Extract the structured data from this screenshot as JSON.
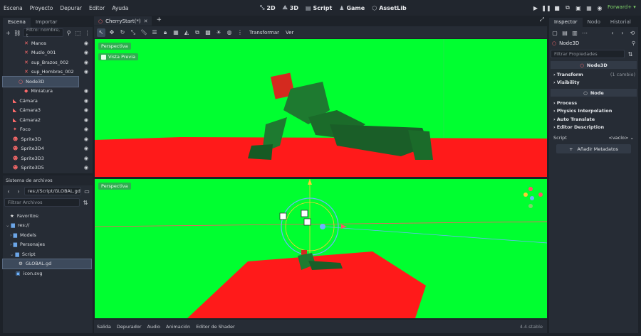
{
  "menubar": {
    "menus": [
      "Escena",
      "Proyecto",
      "Depurar",
      "Editor",
      "Ayuda"
    ],
    "workspaces": [
      {
        "label": "2D",
        "icon": "2d-icon"
      },
      {
        "label": "3D",
        "icon": "3d-icon"
      },
      {
        "label": "Script",
        "icon": "script-icon"
      },
      {
        "label": "Game",
        "icon": "game-icon"
      },
      {
        "label": "AssetLib",
        "icon": "assetlib-icon"
      }
    ],
    "renderer": "Forward+"
  },
  "scene_panel": {
    "tabs": [
      "Escena",
      "Importar"
    ],
    "filter_placeholder": "Filtro: nombre, t",
    "nodes": [
      {
        "label": "Manos",
        "icon": "bone-icon"
      },
      {
        "label": "Muslo_001",
        "icon": "bone-icon"
      },
      {
        "label": "sup_Brazos_002",
        "icon": "bone-icon"
      },
      {
        "label": "sup_Hombros_002",
        "icon": "bone-icon"
      },
      {
        "label": "Node3D",
        "icon": "node3d-icon"
      },
      {
        "label": "Miniatura",
        "icon": "mesh-icon"
      },
      {
        "label": "Cámara",
        "icon": "camera-icon"
      },
      {
        "label": "Cámara3",
        "icon": "camera-icon"
      },
      {
        "label": "Cámara2",
        "icon": "camera-icon"
      },
      {
        "label": "Foco",
        "icon": "light-icon"
      },
      {
        "label": "Sprite3D",
        "icon": "sprite-icon"
      },
      {
        "label": "Sprite3D4",
        "icon": "sprite-icon"
      },
      {
        "label": "Sprite3D3",
        "icon": "sprite-icon"
      },
      {
        "label": "Sprite3D5",
        "icon": "sprite-icon"
      }
    ]
  },
  "filesystem_panel": {
    "title": "Sistema de archivos",
    "path": "res://Script/GLOBAL.gd",
    "filter_placeholder": "Filtrar Archivos",
    "items": [
      {
        "label": "Favoritos:",
        "icon": "star-icon"
      },
      {
        "label": "res://",
        "icon": "folder-icon"
      },
      {
        "label": "Models",
        "icon": "folder-icon"
      },
      {
        "label": "Personajes",
        "icon": "folder-icon"
      },
      {
        "label": "Script",
        "icon": "folder-icon"
      },
      {
        "label": "GLOBAL.gd",
        "icon": "gear-icon"
      },
      {
        "label": "icon.svg",
        "icon": "image-icon"
      }
    ]
  },
  "editor": {
    "scene_tab": "CherryStart(*)",
    "toolbar_menus": [
      "Transformar",
      "Ver"
    ],
    "top_viewport": {
      "label": "Perspectiva",
      "preview_label": "Vista Previa"
    },
    "bottom_viewport": {
      "label": "Perspectiva"
    }
  },
  "bottom_bar": {
    "tabs": [
      "Salida",
      "Depurador",
      "Audio",
      "Animación",
      "Editor de Shader"
    ],
    "version": "4.4.stable"
  },
  "inspector": {
    "tabs": [
      "Inspector",
      "Nodo",
      "Historial"
    ],
    "node_name": "Node3D",
    "filter_placeholder": "Filtrar Propiedades",
    "class_header": "Node3D",
    "sections": [
      {
        "label": "Transform",
        "note": "(1 cambio)"
      },
      {
        "label": "Visibility",
        "note": ""
      }
    ],
    "node_header": "Node",
    "node_sections": [
      "Process",
      "Physics Interpolation",
      "Auto Translate",
      "Editor Description"
    ],
    "script_label": "Script",
    "script_value": "<vacío>",
    "add_metadata": "Añadir Metadatos"
  },
  "colors": {
    "viewport_bg": "#00ff30",
    "floor": "#ff1a1a",
    "accent": "#6db3ff"
  }
}
